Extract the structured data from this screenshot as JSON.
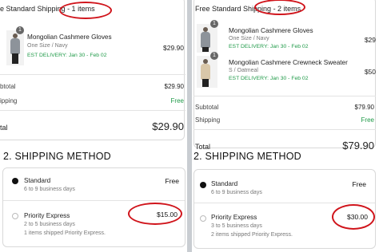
{
  "left": {
    "header": "e Standard Shipping - 1 items",
    "item": {
      "qty": "1",
      "name": "Mongolian Cashmere Gloves",
      "option": "One Size / Navy",
      "delivery": "EST DELIVERY: Jan 30 - Feb 02",
      "price": "$29.90"
    },
    "subtotal_label": "btotal",
    "subtotal_value": "$29.90",
    "shipping_label": "ipping",
    "shipping_value": "Free",
    "total_label": "tal",
    "total_value": "$29.90",
    "section_title": "2. SHIPPING METHOD",
    "methods": [
      {
        "name": "Standard",
        "sub": "6 to 9 business days",
        "price": "Free",
        "selected": true
      },
      {
        "name": "Priority Express",
        "sub": "2 to 5 business days",
        "sub2": "1 items shipped Priority Express.",
        "price": "$15.00",
        "selected": false
      }
    ]
  },
  "right": {
    "header": "Free Standard Shipping - 2 items",
    "items": [
      {
        "qty": "1",
        "name": "Mongolian Cashmere Gloves",
        "option": "One Size / Navy",
        "delivery": "EST DELIVERY: Jan 30 - Feb 02",
        "price": "$29"
      },
      {
        "qty": "1",
        "name": "Mongolian Cashmere Crewneck Sweater",
        "option": "S / Oatmeal",
        "delivery": "EST DELIVERY: Jan 30 - Feb 02",
        "price": "$50"
      }
    ],
    "subtotal_label": "Subtotal",
    "subtotal_value": "$79.90",
    "shipping_label": "Shipping",
    "shipping_value": "Free",
    "total_label": "Total",
    "total_value": "$79.90",
    "section_title": "2. SHIPPING METHOD",
    "methods": [
      {
        "name": "Standard",
        "sub": "6 to 9 business days",
        "price": "Free",
        "selected": true
      },
      {
        "name": "Priority Express",
        "sub": "3 to 5 business days",
        "sub2": "2 items shipped Priority Express.",
        "price": "$30.00",
        "selected": false
      }
    ]
  },
  "colors": {
    "annotation_red": "#d0141b",
    "delivery_green": "#1f9a48",
    "divider_gray": "#c9cdd2"
  }
}
